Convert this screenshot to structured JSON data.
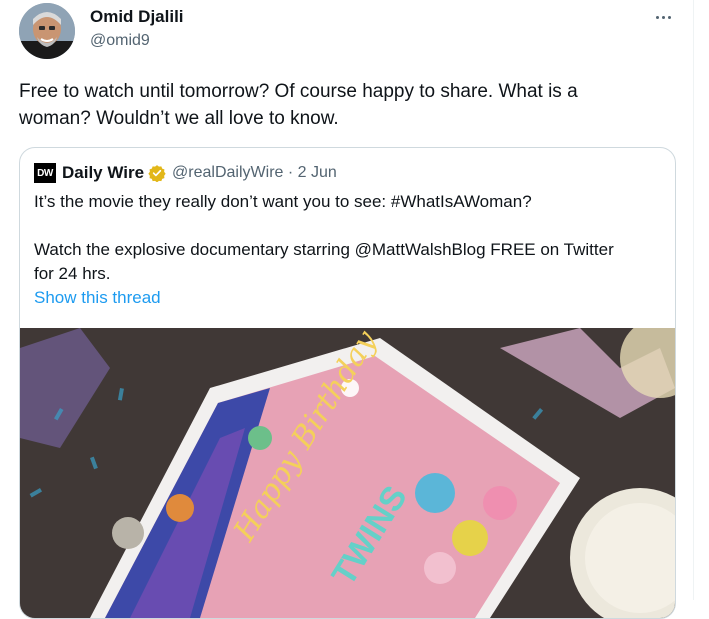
{
  "author": {
    "name": "Omid Djalili",
    "handle": "@omid9"
  },
  "tweet": {
    "text_line1": "Free to watch until tomorrow? Of course happy to share. What is a",
    "text_line2": "woman? Wouldn’t we all love to know."
  },
  "quoted": {
    "logo_text": "DW",
    "name": "Daily Wire",
    "handle_date": "@realDailyWire · 2 Jun",
    "line1": "It’s the movie they really don’t want you to see: #WhatIsAWoman?",
    "line2": "Watch the explosive documentary starring @MattWalshBlog FREE on Twitter",
    "line3": "for 24 hrs.",
    "show_thread": "Show this thread",
    "media": {
      "cake_script": "Happy Birthday",
      "cake_word": "TWINS"
    }
  },
  "icons": {
    "more": "more-horizontal-icon",
    "verified": "verified-badge-icon"
  },
  "colors": {
    "link": "#1d9bf0",
    "secondary_text": "#536471",
    "verified_gold": "#e2b719"
  }
}
